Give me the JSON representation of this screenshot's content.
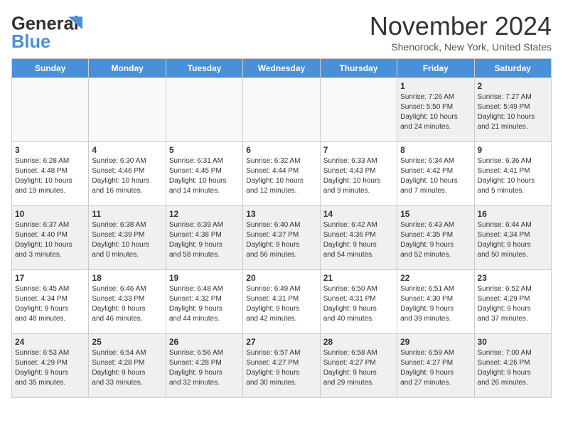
{
  "header": {
    "month_title": "November 2024",
    "location": "Shenorock, New York, United States",
    "logo_general": "General",
    "logo_blue": "Blue"
  },
  "weekdays": [
    "Sunday",
    "Monday",
    "Tuesday",
    "Wednesday",
    "Thursday",
    "Friday",
    "Saturday"
  ],
  "weeks": [
    [
      {
        "day": "",
        "info": ""
      },
      {
        "day": "",
        "info": ""
      },
      {
        "day": "",
        "info": ""
      },
      {
        "day": "",
        "info": ""
      },
      {
        "day": "",
        "info": ""
      },
      {
        "day": "1",
        "info": "Sunrise: 7:26 AM\nSunset: 5:50 PM\nDaylight: 10 hours\nand 24 minutes."
      },
      {
        "day": "2",
        "info": "Sunrise: 7:27 AM\nSunset: 5:49 PM\nDaylight: 10 hours\nand 21 minutes."
      }
    ],
    [
      {
        "day": "3",
        "info": "Sunrise: 6:28 AM\nSunset: 4:48 PM\nDaylight: 10 hours\nand 19 minutes."
      },
      {
        "day": "4",
        "info": "Sunrise: 6:30 AM\nSunset: 4:46 PM\nDaylight: 10 hours\nand 16 minutes."
      },
      {
        "day": "5",
        "info": "Sunrise: 6:31 AM\nSunset: 4:45 PM\nDaylight: 10 hours\nand 14 minutes."
      },
      {
        "day": "6",
        "info": "Sunrise: 6:32 AM\nSunset: 4:44 PM\nDaylight: 10 hours\nand 12 minutes."
      },
      {
        "day": "7",
        "info": "Sunrise: 6:33 AM\nSunset: 4:43 PM\nDaylight: 10 hours\nand 9 minutes."
      },
      {
        "day": "8",
        "info": "Sunrise: 6:34 AM\nSunset: 4:42 PM\nDaylight: 10 hours\nand 7 minutes."
      },
      {
        "day": "9",
        "info": "Sunrise: 6:36 AM\nSunset: 4:41 PM\nDaylight: 10 hours\nand 5 minutes."
      }
    ],
    [
      {
        "day": "10",
        "info": "Sunrise: 6:37 AM\nSunset: 4:40 PM\nDaylight: 10 hours\nand 3 minutes."
      },
      {
        "day": "11",
        "info": "Sunrise: 6:38 AM\nSunset: 4:39 PM\nDaylight: 10 hours\nand 0 minutes."
      },
      {
        "day": "12",
        "info": "Sunrise: 6:39 AM\nSunset: 4:38 PM\nDaylight: 9 hours\nand 58 minutes."
      },
      {
        "day": "13",
        "info": "Sunrise: 6:40 AM\nSunset: 4:37 PM\nDaylight: 9 hours\nand 56 minutes."
      },
      {
        "day": "14",
        "info": "Sunrise: 6:42 AM\nSunset: 4:36 PM\nDaylight: 9 hours\nand 54 minutes."
      },
      {
        "day": "15",
        "info": "Sunrise: 6:43 AM\nSunset: 4:35 PM\nDaylight: 9 hours\nand 52 minutes."
      },
      {
        "day": "16",
        "info": "Sunrise: 6:44 AM\nSunset: 4:34 PM\nDaylight: 9 hours\nand 50 minutes."
      }
    ],
    [
      {
        "day": "17",
        "info": "Sunrise: 6:45 AM\nSunset: 4:34 PM\nDaylight: 9 hours\nand 48 minutes."
      },
      {
        "day": "18",
        "info": "Sunrise: 6:46 AM\nSunset: 4:33 PM\nDaylight: 9 hours\nand 46 minutes."
      },
      {
        "day": "19",
        "info": "Sunrise: 6:48 AM\nSunset: 4:32 PM\nDaylight: 9 hours\nand 44 minutes."
      },
      {
        "day": "20",
        "info": "Sunrise: 6:49 AM\nSunset: 4:31 PM\nDaylight: 9 hours\nand 42 minutes."
      },
      {
        "day": "21",
        "info": "Sunrise: 6:50 AM\nSunset: 4:31 PM\nDaylight: 9 hours\nand 40 minutes."
      },
      {
        "day": "22",
        "info": "Sunrise: 6:51 AM\nSunset: 4:30 PM\nDaylight: 9 hours\nand 39 minutes."
      },
      {
        "day": "23",
        "info": "Sunrise: 6:52 AM\nSunset: 4:29 PM\nDaylight: 9 hours\nand 37 minutes."
      }
    ],
    [
      {
        "day": "24",
        "info": "Sunrise: 6:53 AM\nSunset: 4:29 PM\nDaylight: 9 hours\nand 35 minutes."
      },
      {
        "day": "25",
        "info": "Sunrise: 6:54 AM\nSunset: 4:28 PM\nDaylight: 9 hours\nand 33 minutes."
      },
      {
        "day": "26",
        "info": "Sunrise: 6:56 AM\nSunset: 4:28 PM\nDaylight: 9 hours\nand 32 minutes."
      },
      {
        "day": "27",
        "info": "Sunrise: 6:57 AM\nSunset: 4:27 PM\nDaylight: 9 hours\nand 30 minutes."
      },
      {
        "day": "28",
        "info": "Sunrise: 6:58 AM\nSunset: 4:27 PM\nDaylight: 9 hours\nand 29 minutes."
      },
      {
        "day": "29",
        "info": "Sunrise: 6:59 AM\nSunset: 4:27 PM\nDaylight: 9 hours\nand 27 minutes."
      },
      {
        "day": "30",
        "info": "Sunrise: 7:00 AM\nSunset: 4:26 PM\nDaylight: 9 hours\nand 26 minutes."
      }
    ]
  ]
}
